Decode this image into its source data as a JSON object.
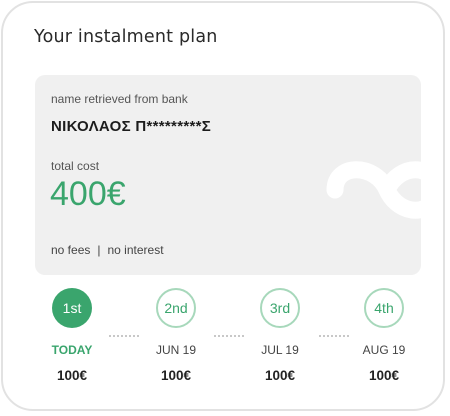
{
  "plan": {
    "title": "Your instalment plan"
  },
  "summary": {
    "holder_label": "name retrieved from bank",
    "holder_name": "ΝΙΚΟΛΑΟΣ Π*********Σ",
    "cost_label": "total cost",
    "cost_value": "400€",
    "fees_text": "no fees",
    "separator": "|",
    "interest_text": "no interest",
    "logo_icon": "brand-logo-watermark-icon"
  },
  "colors": {
    "accent": "#3aa56d",
    "accent_light": "#a7d8bb",
    "panel_bg": "#f0f0f0",
    "card_border": "#e2e2e2"
  },
  "instalments": [
    {
      "step": "1st",
      "date": "TODAY",
      "amount": "100€",
      "status": "current"
    },
    {
      "step": "2nd",
      "date": "JUN 19",
      "amount": "100€",
      "status": "upcoming"
    },
    {
      "step": "3rd",
      "date": "JUL 19",
      "amount": "100€",
      "status": "upcoming"
    },
    {
      "step": "4th",
      "date": "AUG 19",
      "amount": "100€",
      "status": "upcoming"
    }
  ]
}
